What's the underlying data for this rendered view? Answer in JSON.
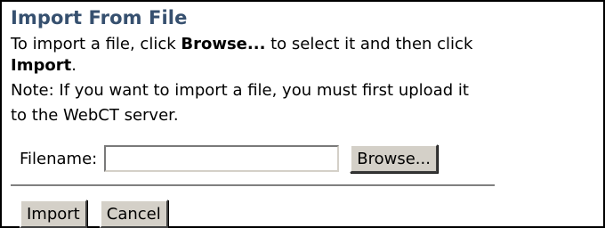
{
  "panel": {
    "title": "Import From File",
    "line1_prefix": "To import a file, click ",
    "line1_bold": "Browse...",
    "line1_suffix": " to select it and then click",
    "line2_bold": "Import",
    "line2_suffix": ".",
    "line3": "Note: If you want to import a file, you must first upload it",
    "line4": "to the WebCT server."
  },
  "form": {
    "filename_label": "Filename:",
    "filename_value": "",
    "browse_label": "Browse..."
  },
  "actions": {
    "import_label": "Import",
    "cancel_label": "Cancel"
  }
}
